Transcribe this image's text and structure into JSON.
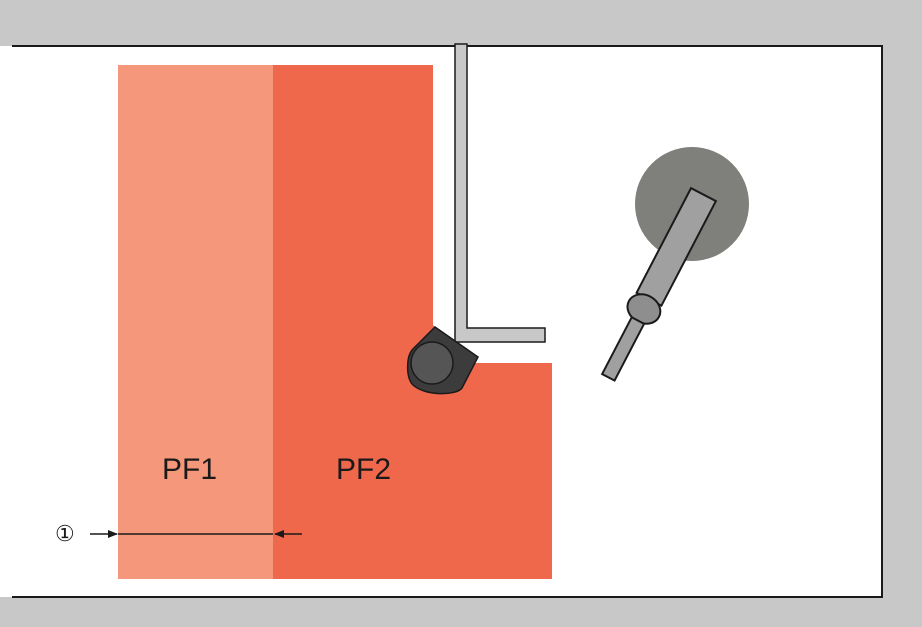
{
  "fields": {
    "pf1_label": "PF1",
    "pf2_label": "PF2"
  },
  "dimension": {
    "marker": "①"
  },
  "colors": {
    "wall": "#c8c8c8",
    "pf1": "#f5977a",
    "pf2": "#f0684c",
    "fence": "#c8c8c8",
    "scanner_body": "#3c3c3c",
    "scanner_lens": "#555555",
    "robot_base": "#7f7f7b",
    "robot_arm": "#a0a0a0",
    "outline": "#1a1a1a"
  },
  "icons": {
    "scanner": "safety-laser-scanner-icon",
    "robot": "robot-arm-icon"
  }
}
